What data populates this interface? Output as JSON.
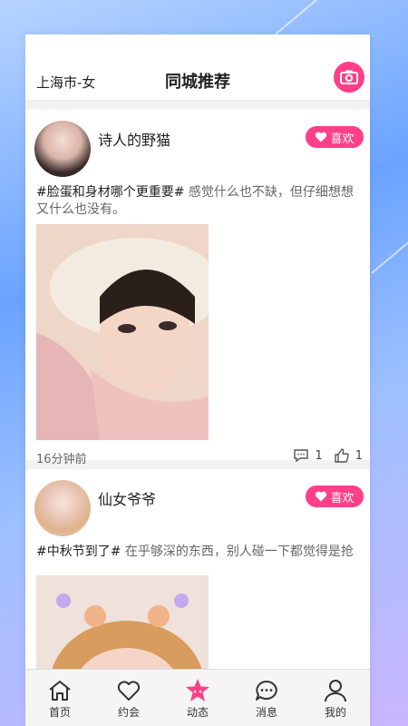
{
  "header": {
    "location_label": "上海市-女",
    "title": "同城推荐"
  },
  "posts": [
    {
      "username": "诗人的野猫",
      "like_label": "喜欢",
      "topic": "#脸蛋和身材哪个更重要#",
      "text": " 感觉什么也不缺，但仔细想想又什么也没有。",
      "time": "16分钟前",
      "comments": "1",
      "likes": "1"
    },
    {
      "username": "仙女爷爷",
      "like_label": "喜欢",
      "topic": "#中秋节到了#",
      "text": " 在乎够深的东西，别人碰一下都觉得是抢"
    }
  ],
  "tabbar": {
    "items": [
      {
        "label": "首页",
        "icon": "home-icon"
      },
      {
        "label": "约会",
        "icon": "heart-icon"
      },
      {
        "label": "动态",
        "icon": "star-icon",
        "active": true
      },
      {
        "label": "消息",
        "icon": "chat-icon"
      },
      {
        "label": "我的",
        "icon": "user-icon"
      }
    ]
  },
  "colors": {
    "accent": "#ff3f88",
    "text": "#222222",
    "muted": "#666666"
  }
}
